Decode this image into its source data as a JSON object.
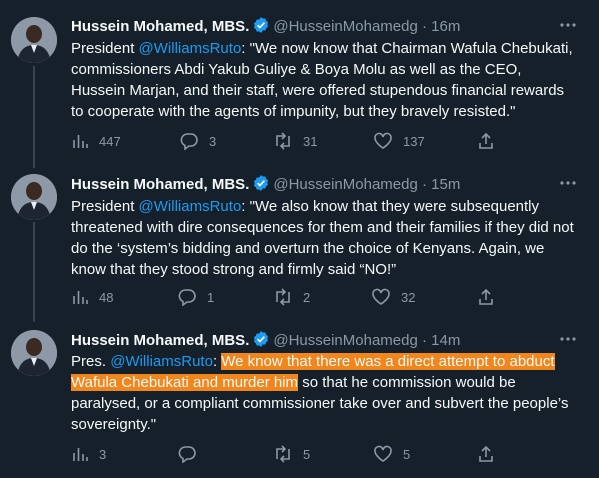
{
  "tweets": [
    {
      "name": "Hussein Mohamed, MBS.",
      "handle": "@HusseinMohamedg",
      "dot": "·",
      "time": "16m",
      "prefix": "President ",
      "mention": "@WilliamsRuto",
      "highlight": "",
      "text": ": \"We now know that Chairman Wafula Chebukati, commissioners Abdi Yakub Guliye & Boya Molu as well as the CEO, Hussein Marjan, and their staff, were offered stupendous financial rewards to cooperate with the agents of impunity, but they bravely resisted.\"",
      "views": "447",
      "replies": "3",
      "retweets": "31",
      "likes": "137"
    },
    {
      "name": "Hussein Mohamed, MBS.",
      "handle": "@HusseinMohamedg",
      "dot": "·",
      "time": "15m",
      "prefix": "President ",
      "mention": "@WilliamsRuto",
      "highlight": "",
      "text": ": \"We also know that they were subsequently threatened with dire consequences for them and their families if they did not do the ‘system’s bidding and overturn the choice of Kenyans. Again, we know that they stood strong and firmly said “NO!”",
      "views": "48",
      "replies": "1",
      "retweets": "2",
      "likes": "32"
    },
    {
      "name": "Hussein Mohamed, MBS.",
      "handle": "@HusseinMohamedg",
      "dot": "·",
      "time": "14m",
      "prefix": "Pres. ",
      "mention": "@WilliamsRuto",
      "colon": ": ",
      "highlight": "We know that there was a direct attempt to abduct Wafula Chebukati and murder him",
      "text": " so that he commission would be paralysed, or a compliant commissioner take over and subvert the people’s sovereignty.\"",
      "views": "3",
      "replies": "",
      "retweets": "5",
      "likes": "5"
    }
  ],
  "icons": {
    "verified": "verified-badge-icon",
    "more": "more-icon",
    "views": "views-icon",
    "reply": "reply-icon",
    "retweet": "retweet-icon",
    "like": "like-icon",
    "share": "share-icon"
  },
  "colors": {
    "background": "#15202b",
    "text": "#f7f9f9",
    "secondary": "#8b98a5",
    "link": "#1d9bf0",
    "highlight": "#f0861c",
    "verified": "#1d9bf0"
  }
}
